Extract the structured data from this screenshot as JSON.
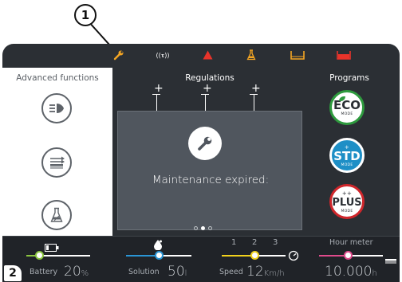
{
  "annotations": {
    "callout_1": "1",
    "callout_2": "2"
  },
  "status_icons": [
    {
      "name": "wrench-icon",
      "color": "#f5a623"
    },
    {
      "name": "radio-signal-icon",
      "label": "((τ))",
      "color": "#ffffff"
    },
    {
      "name": "warning-triangle-icon",
      "color": "#e8332a"
    },
    {
      "name": "flask-alert-icon",
      "color": "#f5a623"
    },
    {
      "name": "tank-empty-icon",
      "color": "#f5a623"
    },
    {
      "name": "tank-full-icon",
      "color": "#e8332a"
    }
  ],
  "advanced": {
    "title": "Advanced functions",
    "buttons": [
      {
        "name": "headlight-icon"
      },
      {
        "name": "brush-pressure-icon"
      },
      {
        "name": "detergent-flask-icon"
      }
    ]
  },
  "regulations": {
    "title": "Regulations",
    "plus_labels": [
      "+",
      "+",
      "+"
    ]
  },
  "dialog": {
    "message": "Maintenance expired:"
  },
  "pager": {
    "pages": 3,
    "active_index": 1
  },
  "programs": {
    "title": "Programs",
    "items": [
      {
        "label": "ECO",
        "sub": "MODE",
        "color": "#2e9b3e",
        "prefix": ""
      },
      {
        "label": "STD",
        "sub": "MODE",
        "color": "#1e8fc6",
        "prefix": "+"
      },
      {
        "label": "PLUS",
        "sub": "MODE",
        "color": "#d0262b",
        "prefix": "++"
      }
    ]
  },
  "readouts": {
    "battery": {
      "label": "Battery",
      "value": "20",
      "unit": "%",
      "color": "#8bc540",
      "level": 0.2
    },
    "solution": {
      "label": "Solution",
      "value": "50",
      "unit": "l",
      "color": "#2a95d5",
      "level": 0.5
    },
    "speed": {
      "label": "Speed",
      "value": "12",
      "unit": "Km/h",
      "color": "#f2d21d",
      "ticks": [
        "1",
        "2",
        "3"
      ],
      "level": 0.52
    },
    "hours": {
      "label": "Hour meter",
      "value": "10.000",
      "unit": "h",
      "color": "#e04b8c",
      "level": 0.45
    }
  }
}
